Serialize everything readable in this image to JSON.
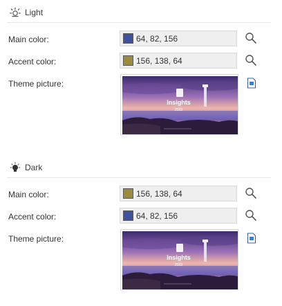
{
  "light": {
    "title": "Light",
    "icon": "sun-icon",
    "main_color": {
      "label": "Main color:",
      "value": "64, 82, 156",
      "swatch": "#40529c"
    },
    "accent_color": {
      "label": "Accent color:",
      "value": "156, 138, 64",
      "swatch": "#9c8a40"
    },
    "theme_picture": {
      "label": "Theme picture:",
      "title": "Insights",
      "year": "2023"
    }
  },
  "dark": {
    "title": "Dark",
    "icon": "bulb-icon",
    "main_color": {
      "label": "Main color:",
      "value": "156, 138, 64",
      "swatch": "#9c8a40"
    },
    "accent_color": {
      "label": "Accent color:",
      "value": "64, 82, 156",
      "swatch": "#40529c"
    },
    "theme_picture": {
      "label": "Theme picture:",
      "title": "Insights",
      "year": "2023"
    }
  },
  "icons": {
    "search": "search-icon",
    "picture_file": "file-icon"
  }
}
